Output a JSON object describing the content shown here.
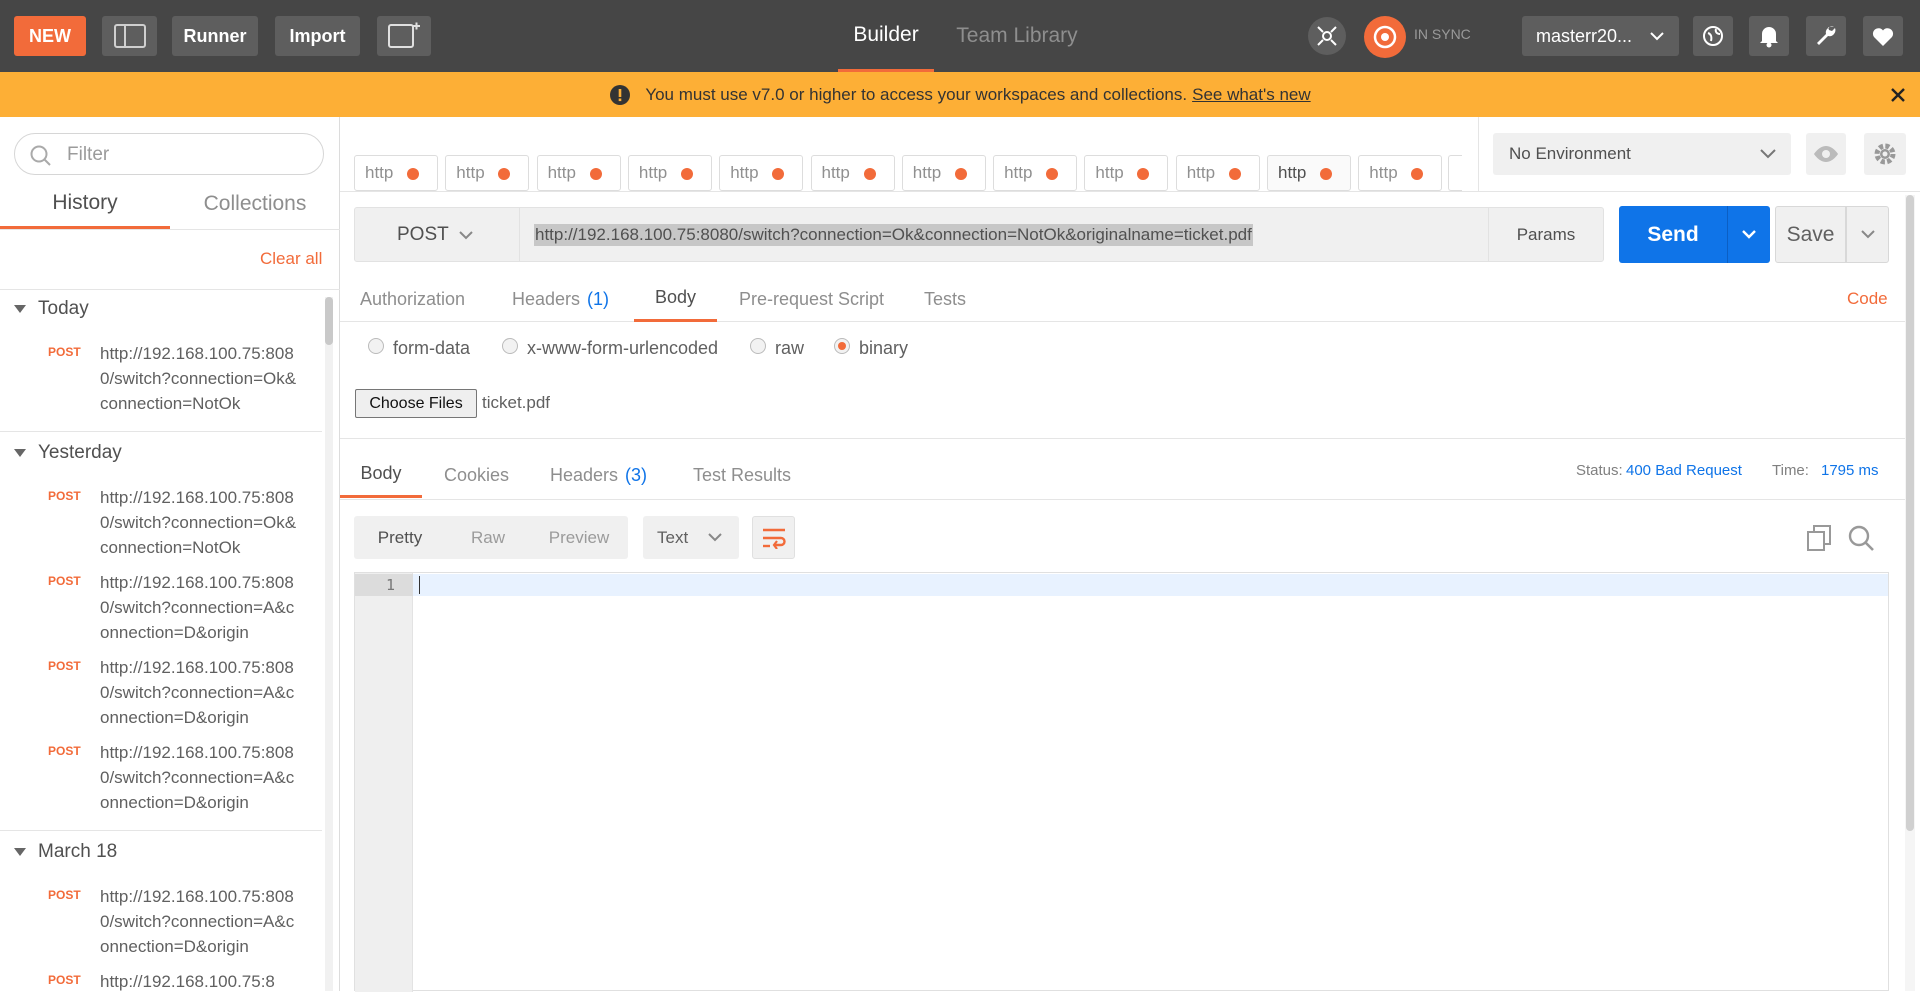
{
  "topbar": {
    "new_label": "NEW",
    "runner_label": "Runner",
    "import_label": "Import",
    "builder_label": "Builder",
    "team_library_label": "Team Library",
    "sync_status": "IN SYNC",
    "workspace_label": "masterr20..."
  },
  "banner": {
    "message": "You must use v7.0 or higher to access your workspaces and collections.",
    "link": "See what's new"
  },
  "sidebar": {
    "filter_placeholder": "Filter",
    "tab_history": "History",
    "tab_collections": "Collections",
    "clear_all": "Clear all",
    "groups": [
      {
        "title": "Today",
        "items": [
          {
            "method": "POST",
            "url": "http://192.168.100.75:8080/switch?connection=Ok&connection=NotOk"
          }
        ]
      },
      {
        "title": "Yesterday",
        "items": [
          {
            "method": "POST",
            "url": "http://192.168.100.75:8080/switch?connection=Ok&connection=NotOk"
          },
          {
            "method": "POST",
            "url": "http://192.168.100.75:8080/switch?connection=A&connection=D&origin"
          },
          {
            "method": "POST",
            "url": "http://192.168.100.75:8080/switch?connection=A&connection=D&origin"
          },
          {
            "method": "POST",
            "url": "http://192.168.100.75:8080/switch?connection=A&connection=D&origin"
          }
        ]
      },
      {
        "title": "March 18",
        "items": [
          {
            "method": "POST",
            "url": "http://192.168.100.75:8080/switch?connection=A&connection=D&origin"
          },
          {
            "method": "POST",
            "url": "http://192.168.100.75:8"
          }
        ]
      }
    ]
  },
  "request_tabs": [
    "http",
    "http",
    "http",
    "http",
    "http",
    "http",
    "http",
    "http",
    "http",
    "http",
    "http",
    "http"
  ],
  "environment": {
    "selected": "No Environment"
  },
  "request": {
    "method": "POST",
    "url": "http://192.168.100.75:8080/switch?connection=Ok&connection=NotOk&originalname=ticket.pdf",
    "params_label": "Params",
    "send_label": "Send",
    "save_label": "Save"
  },
  "request_subtabs": {
    "authorization": "Authorization",
    "headers": "Headers",
    "headers_count": "(1)",
    "body": "Body",
    "prerequest": "Pre-request Script",
    "tests": "Tests",
    "code": "Code"
  },
  "body_options": {
    "form_data": "form-data",
    "urlencoded": "x-www-form-urlencoded",
    "raw": "raw",
    "binary": "binary",
    "selected": "binary"
  },
  "file": {
    "choose_label": "Choose Files",
    "filename": "ticket.pdf"
  },
  "response_tabs": {
    "body": "Body",
    "cookies": "Cookies",
    "headers": "Headers",
    "headers_count": "(3)",
    "test_results": "Test Results"
  },
  "response_status": {
    "status_label": "Status:",
    "status_value": "400 Bad Request",
    "time_label": "Time:",
    "time_value": "1795 ms"
  },
  "response_view": {
    "pretty": "Pretty",
    "raw": "Raw",
    "preview": "Preview",
    "format": "Text"
  },
  "editor": {
    "line_number": "1"
  },
  "colors": {
    "accent": "#f26b3a",
    "blue": "#0f74e8",
    "banner": "#fdaf36",
    "topbar": "#464646"
  }
}
